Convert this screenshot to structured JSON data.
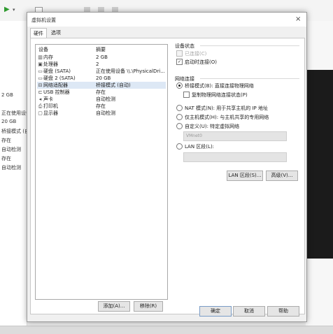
{
  "dialog": {
    "title": "虚拟机设置",
    "tabs": {
      "hardware": "硬件",
      "options": "选项"
    },
    "close_glyph": "×"
  },
  "device_list": {
    "header": {
      "device": "设备",
      "summary": "摘要"
    },
    "rows": [
      {
        "icon": "memory-icon",
        "glyph": "▥",
        "name": "内存",
        "summary": "2 GB"
      },
      {
        "icon": "cpu-icon",
        "glyph": "▣",
        "name": "处理器",
        "summary": "2"
      },
      {
        "icon": "disk-icon",
        "glyph": "▭",
        "name": "硬盘 (SATA)",
        "summary": "正在使用设备 \\\\.\\PhysicalDri..."
      },
      {
        "icon": "disk-icon",
        "glyph": "▭",
        "name": "硬盘 2 (SATA)",
        "summary": "20 GB"
      },
      {
        "icon": "network-icon",
        "glyph": "⊟",
        "name": "网络适配器",
        "summary": "桥接模式 (自动)"
      },
      {
        "icon": "usb-icon",
        "glyph": "⊏",
        "name": "USB 控制器",
        "summary": "存在"
      },
      {
        "icon": "sound-icon",
        "glyph": "◂",
        "name": "声卡",
        "summary": "自动检测"
      },
      {
        "icon": "printer-icon",
        "glyph": "⎙",
        "name": "打印机",
        "summary": "存在"
      },
      {
        "icon": "display-icon",
        "glyph": "▢",
        "name": "显示器",
        "summary": "自动检测"
      }
    ],
    "selected_index": 4
  },
  "buttons": {
    "add": "添加(A)...",
    "remove": "移除(R)",
    "ok": "确定",
    "cancel": "取消",
    "help": "帮助",
    "lan_segments": "LAN 区段(S)...",
    "advanced": "高级(V)..."
  },
  "device_status": {
    "title": "设备状态",
    "connected": {
      "label": "已连接(C)",
      "checked": false,
      "enabled": false
    },
    "connect_at_power_on": {
      "label": "启动时连接(O)",
      "checked": true
    }
  },
  "network_connection": {
    "title": "网络连接",
    "bridged": {
      "label": "桥接模式(B): 直接连接物理网络",
      "selected": true
    },
    "replicate": {
      "label": "复制物理网络连接状态(P)",
      "checked": false
    },
    "nat": {
      "label": "NAT 模式(N): 用于共享主机的 IP 地址",
      "selected": false
    },
    "host_only": {
      "label": "仅主机模式(H): 与主机共享的专用网络",
      "selected": false
    },
    "custom": {
      "label": "自定义(U): 特定虚拟网络",
      "selected": false
    },
    "custom_value": "VMnet0",
    "lan_segment": {
      "label": "LAN 区段(L):",
      "selected": false
    },
    "lan_segment_value": ""
  },
  "background": {
    "left_texts": [
      "2 GB",
      "正在使用设备",
      "20 GB",
      "桥接模式 (自",
      "存在",
      "自动检测",
      "存在",
      "自动检测"
    ],
    "toolbar_glyphs": [
      "▶",
      "▾"
    ]
  }
}
